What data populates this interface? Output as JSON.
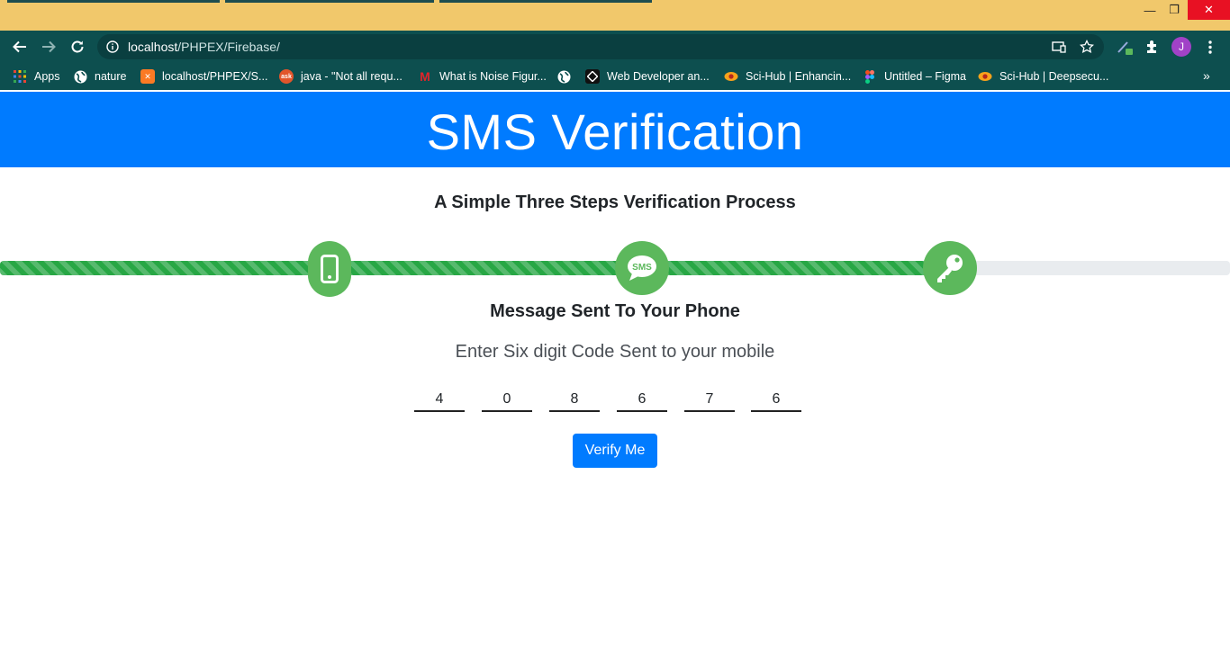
{
  "browser": {
    "window_controls": {
      "minimize": "—",
      "restore": "❐",
      "close": "✕"
    },
    "url_host": "localhost",
    "url_path": "/PHPEX/Firebase/",
    "avatar_letter": "J",
    "bookmarks": [
      {
        "label": "Apps",
        "icon": "apps-grid-icon"
      },
      {
        "label": "nature",
        "icon": "globe-icon"
      },
      {
        "label": "localhost/PHPEX/S...",
        "icon": "xampp-icon"
      },
      {
        "label": "java - \"Not all requ...",
        "icon": "ask-icon"
      },
      {
        "label": "What is Noise Figur...",
        "icon": "m-logo-icon"
      },
      {
        "label": "",
        "icon": "globe-icon"
      },
      {
        "label": "Web Developer an...",
        "icon": "diamond-logo-icon"
      },
      {
        "label": "Sci-Hub | Enhancin...",
        "icon": "scihub-icon"
      },
      {
        "label": "Untitled – Figma",
        "icon": "figma-icon"
      },
      {
        "label": "Sci-Hub | Deepsecu...",
        "icon": "scihub-icon"
      }
    ],
    "bookmarks_overflow": "»"
  },
  "page": {
    "title": "SMS Verification",
    "subtitle": "A Simple Three Steps Verification Process",
    "progress_fraction": 0.755,
    "steps": [
      {
        "icon": "mobile-phone-icon"
      },
      {
        "icon": "sms-bubble-icon",
        "text": "SMS"
      },
      {
        "icon": "key-icon"
      }
    ],
    "message_heading": "Message Sent To Your Phone",
    "message_lead": "Enter Six digit Code Sent to your mobile",
    "code_digits": [
      "4",
      "0",
      "8",
      "6",
      "7",
      "6"
    ],
    "verify_label": "Verify Me"
  },
  "colors": {
    "primary": "#007bff",
    "success": "#28a745",
    "step_icon": "#5cb85c",
    "browser_frame": "#0d4f4f",
    "title_bar": "#f1c86b"
  }
}
